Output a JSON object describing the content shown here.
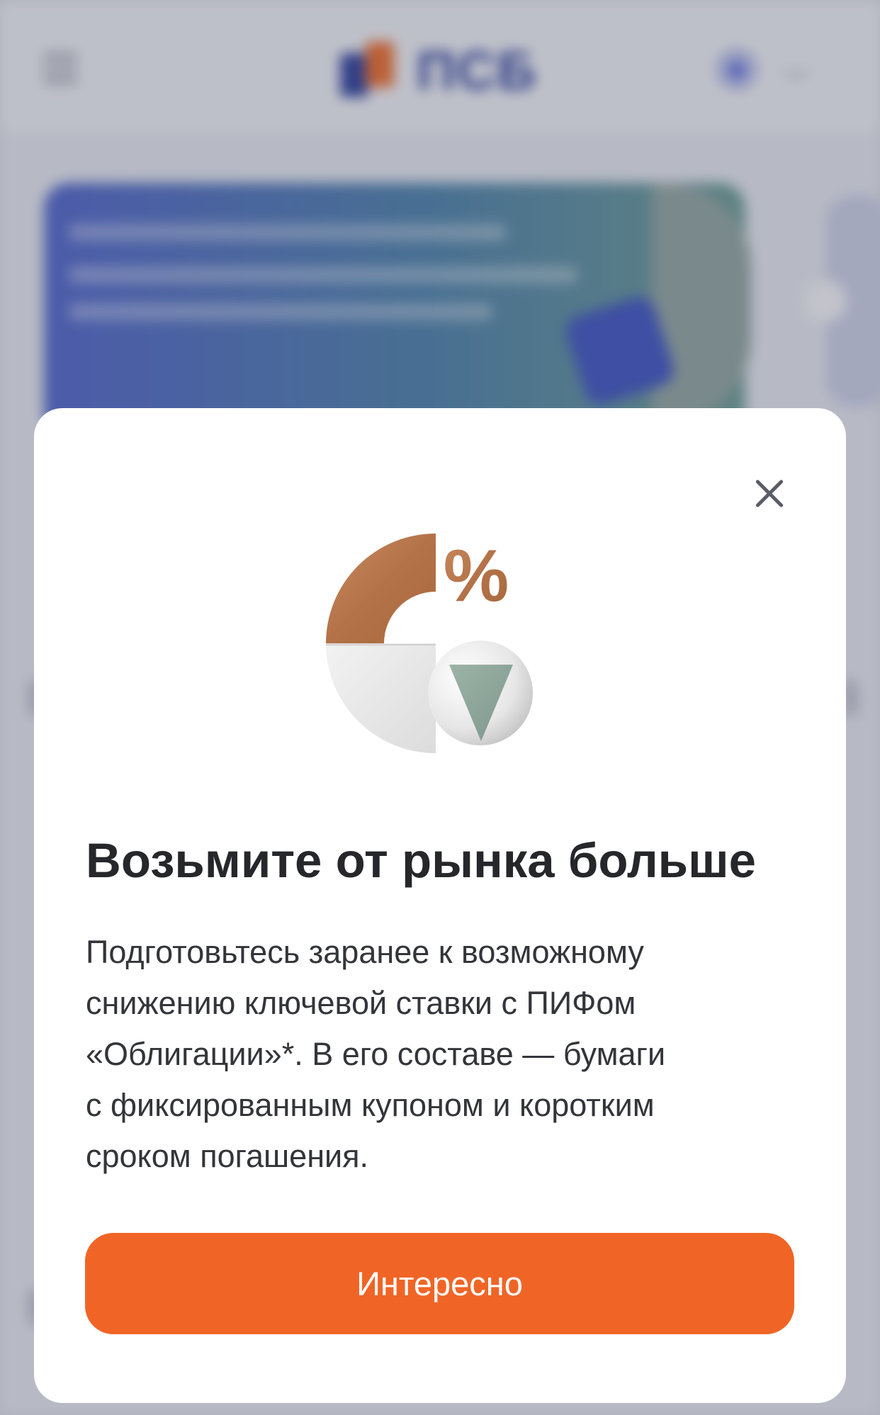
{
  "header": {
    "logo_text": "ПСБ",
    "menu_icon": "hamburger-menu-icon",
    "avatar_icon": "user-avatar-icon",
    "dropdown_icon": "chevron-down-icon"
  },
  "modal": {
    "close_icon": "close-icon",
    "illustration_icon": "percent-pie-chart-icon",
    "title": "Возьмите от рынка больше",
    "text_lines": [
      "Подготовьтесь заранее к возможному",
      "снижению ключевой ставки с ПИФом",
      "«Облигации»*. В его составе — бумаги",
      "с фиксированным купоном и коротким",
      "сроком погашения."
    ],
    "cta_label": "Интересно"
  },
  "colors": {
    "accent": "#f06526",
    "brand_blue": "#2c3e9a",
    "illustration_copper": "#b8764f",
    "illustration_sage": "#8fa89c"
  }
}
